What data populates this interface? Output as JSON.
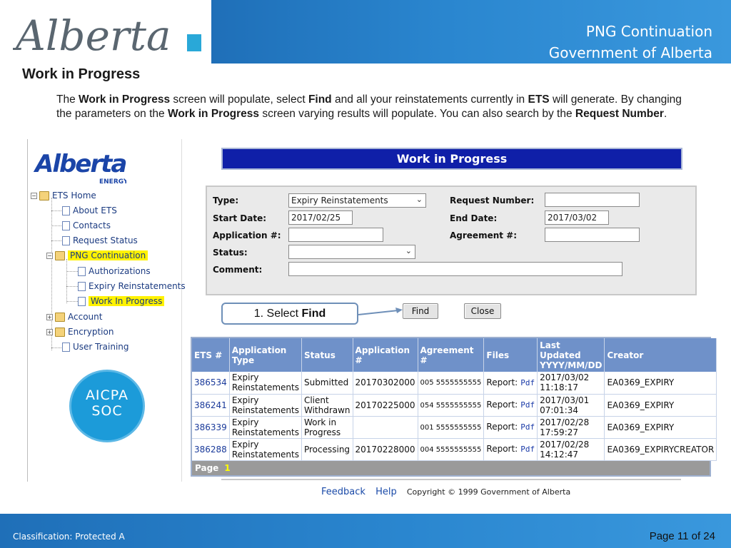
{
  "header": {
    "logo_text": "Alberta",
    "line1": "PNG Continuation",
    "line2": "Government of Alberta"
  },
  "slide": {
    "title": "Work in Progress",
    "intro_parts": [
      "The ",
      "Work in Progress",
      " screen will populate, select ",
      "Find",
      " and all your reinstatements currently in ",
      "ETS",
      " will generate. By changing the parameters on the ",
      "Work in Progress",
      " screen varying results will populate. You can also search by the ",
      "Request Number",
      "."
    ]
  },
  "nav": {
    "logo_text": "Alberta",
    "logo_sub": "ENERGY",
    "items": [
      {
        "label": "ETS Home"
      },
      {
        "label": "About ETS"
      },
      {
        "label": "Contacts"
      },
      {
        "label": "Request Status"
      },
      {
        "label": "PNG Continuation"
      },
      {
        "label": "Authorizations"
      },
      {
        "label": "Expiry Reinstatements"
      },
      {
        "label": "Work In Progress"
      },
      {
        "label": "Account"
      },
      {
        "label": "Encryption"
      },
      {
        "label": "User Training"
      }
    ]
  },
  "badge": {
    "line1": "AICPA",
    "line2": "SOC"
  },
  "wip": {
    "title": "Work in Progress",
    "labels": {
      "type": "Type:",
      "start_date": "Start Date:",
      "application": "Application #:",
      "status": "Status:",
      "comment": "Comment:",
      "request_number": "Request Number:",
      "end_date": "End Date:",
      "agreement": "Agreement #:"
    },
    "values": {
      "type": "Expiry Reinstatements",
      "start_date": "2017/02/25",
      "end_date": "2017/03/02",
      "application": "",
      "status": "",
      "comment": "",
      "request_number": "",
      "agreement": ""
    },
    "find_label": "Find",
    "close_label": "Close"
  },
  "callout": {
    "prefix": "1. Select ",
    "bold": "Find"
  },
  "results": {
    "headers": [
      "ETS #",
      "Application Type",
      "Status",
      "Application #",
      "Agreement #",
      "Files",
      "Last Updated YYYY/MM/DD",
      "Creator"
    ],
    "rows": [
      {
        "ets": "386534",
        "type": "Expiry Reinstatements",
        "status": "Submitted",
        "app": "20170302000",
        "agr": "005 5555555555",
        "files": "Report:",
        "pdf": "Pdf",
        "updated": "2017/03/02 11:18:17",
        "creator": "EA0369_EXPIRY"
      },
      {
        "ets": "386241",
        "type": "Expiry Reinstatements",
        "status": "Client Withdrawn",
        "app": "20170225000",
        "agr": "054 5555555555",
        "files": "Report:",
        "pdf": "Pdf",
        "updated": "2017/03/01 07:01:34",
        "creator": "EA0369_EXPIRY"
      },
      {
        "ets": "386339",
        "type": "Expiry Reinstatements",
        "status": "Work in Progress",
        "app": "",
        "agr": "001 5555555555",
        "files": "Report:",
        "pdf": "Pdf",
        "updated": "2017/02/28 17:59:27",
        "creator": "EA0369_EXPIRY"
      },
      {
        "ets": "386288",
        "type": "Expiry Reinstatements",
        "status": "Processing",
        "app": "20170228000",
        "agr": "004 5555555555",
        "files": "Report:",
        "pdf": "Pdf",
        "updated": "2017/02/28 14:12:47",
        "creator": "EA0369_EXPIRYCREATOR"
      }
    ],
    "page_label": "Page",
    "page_number": "1"
  },
  "footer": {
    "feedback": "Feedback",
    "help": "Help",
    "copyright": "Copyright © 1999 Government of Alberta"
  },
  "bottom": {
    "classification": "Classification: Protected A",
    "page": "Page 11 of 24"
  }
}
